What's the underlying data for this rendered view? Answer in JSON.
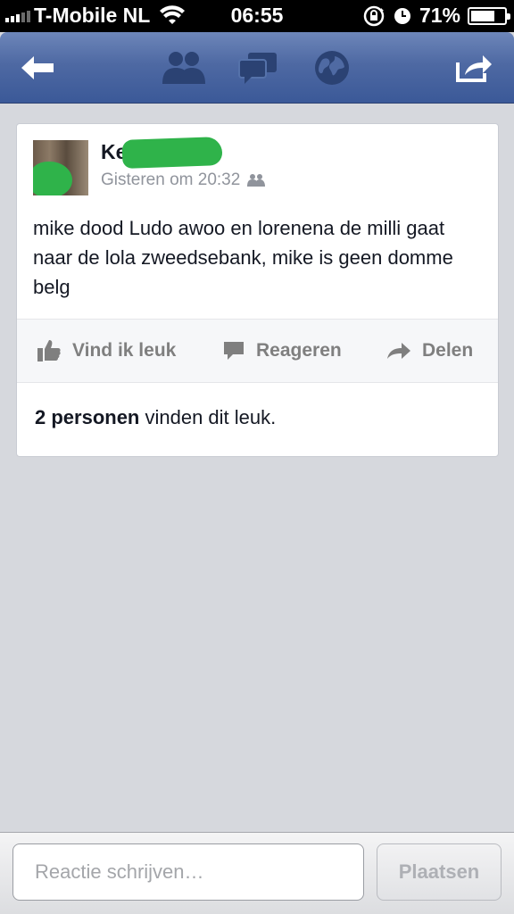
{
  "status_bar": {
    "carrier": "T-Mobile NL",
    "time": "06:55",
    "battery_percent": "71%",
    "battery_level": 0.71,
    "signal_bars": 3
  },
  "nav": {
    "back_icon": "back-arrow-icon",
    "friends_icon": "friends-icon",
    "messages_icon": "messages-icon",
    "notifications_icon": "globe-icon",
    "share_icon": "share-icon",
    "bar_color": "#3b5998"
  },
  "post": {
    "author": "Ke",
    "timestamp": "Gisteren om 20:32",
    "audience_icon": "friends-icon",
    "text": "mike dood Ludo awoo en lorenena de milli gaat naar de lola  zweedsebank, mike is geen domme belg"
  },
  "actions": {
    "like": "Vind ik leuk",
    "comment": "Reageren",
    "share": "Delen"
  },
  "likes": {
    "count": "2 personen",
    "suffix": " vinden dit leuk."
  },
  "composer": {
    "placeholder": "Reactie schrijven…",
    "value": "",
    "post_button": "Plaatsen"
  }
}
